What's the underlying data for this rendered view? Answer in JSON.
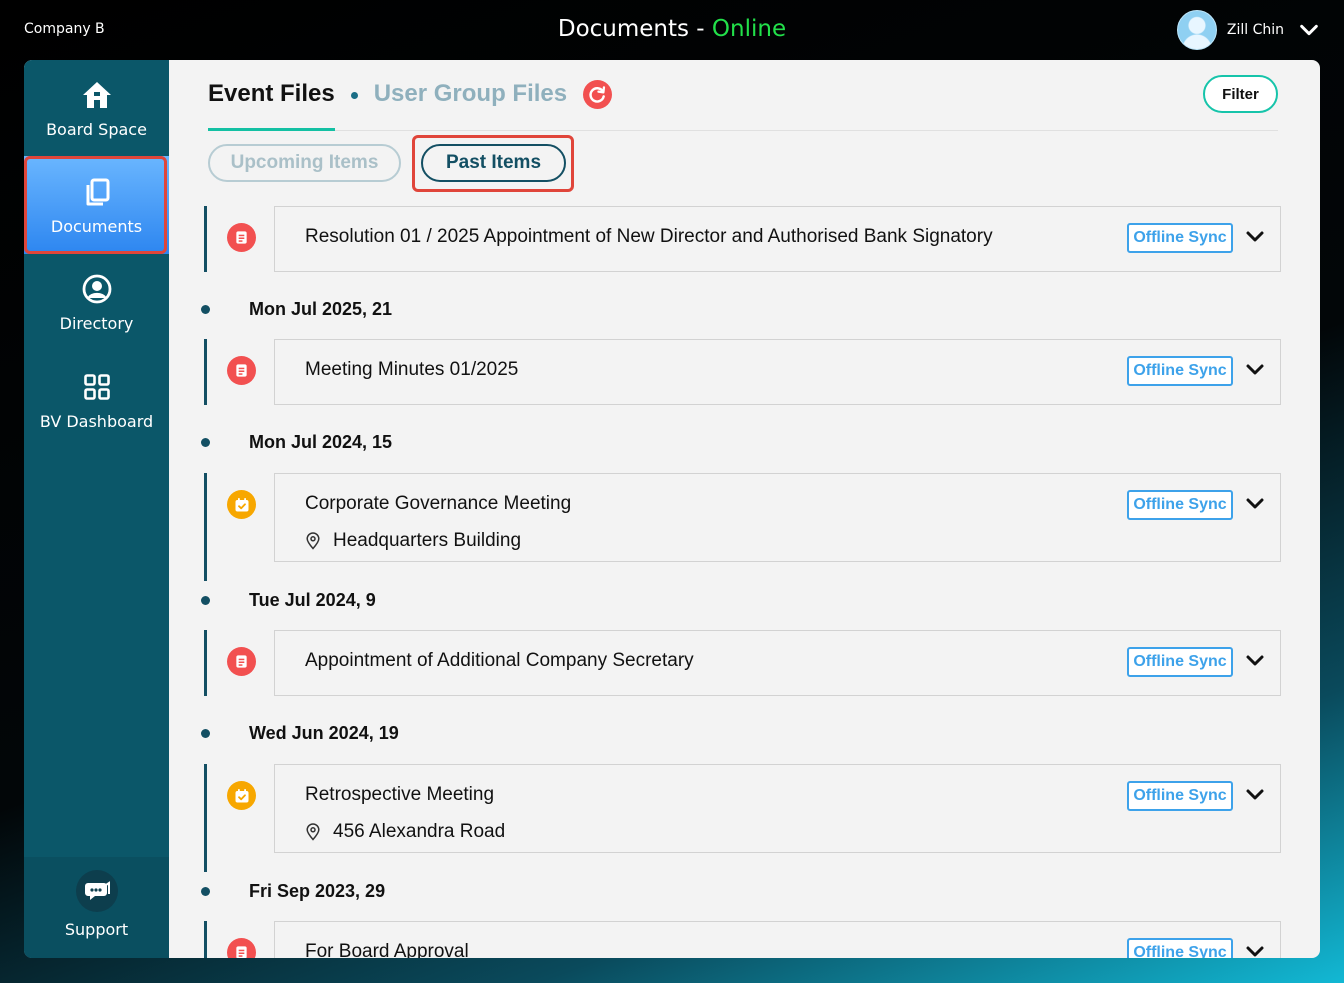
{
  "header": {
    "company": "Company B",
    "title_prefix": "Documents - ",
    "status": "Online",
    "user_name": "Zill Chin"
  },
  "sidebar": {
    "items": [
      {
        "label": "Board Space",
        "icon": "home-icon"
      },
      {
        "label": "Documents",
        "icon": "documents-icon",
        "active": true
      },
      {
        "label": "Directory",
        "icon": "user-circle-icon"
      },
      {
        "label": "BV Dashboard",
        "icon": "grid-icon"
      }
    ],
    "support_label": "Support"
  },
  "tabs": {
    "event_files": "Event Files",
    "user_group_files": "User Group Files",
    "filter": "Filter"
  },
  "toggles": {
    "upcoming": "Upcoming Items",
    "past": "Past Items"
  },
  "timeline": {
    "sync_label": "Offline Sync",
    "dates": [
      "Mon Jul 2025, 21",
      "Mon Jul 2024, 15",
      "Tue Jul 2024, 9",
      "Wed Jun 2024, 19",
      "Fri Sep 2023, 29"
    ],
    "items": [
      {
        "title": "Resolution 01 / 2025 Appointment of New Director and Authorised Bank Signatory",
        "type": "document",
        "location": ""
      },
      {
        "title": "Meeting Minutes 01/2025",
        "type": "document",
        "location": ""
      },
      {
        "title": "Corporate Governance Meeting",
        "type": "meeting",
        "location": "Headquarters Building"
      },
      {
        "title": "Appointment of Additional Company Secretary",
        "type": "document",
        "location": ""
      },
      {
        "title": "Retrospective Meeting",
        "type": "meeting",
        "location": "456 Alexandra Road"
      },
      {
        "title": "For Board Approval",
        "type": "document",
        "location": ""
      }
    ]
  },
  "colors": {
    "online": "#22e04a",
    "sidebar": "#0b5769",
    "active_item": "#2d86f0",
    "accent_teal": "#13c0a3",
    "highlight_red": "#e0453a",
    "sync_blue": "#3da2ea",
    "doc_icon": "#f25050",
    "meeting_icon": "#f7a700"
  }
}
